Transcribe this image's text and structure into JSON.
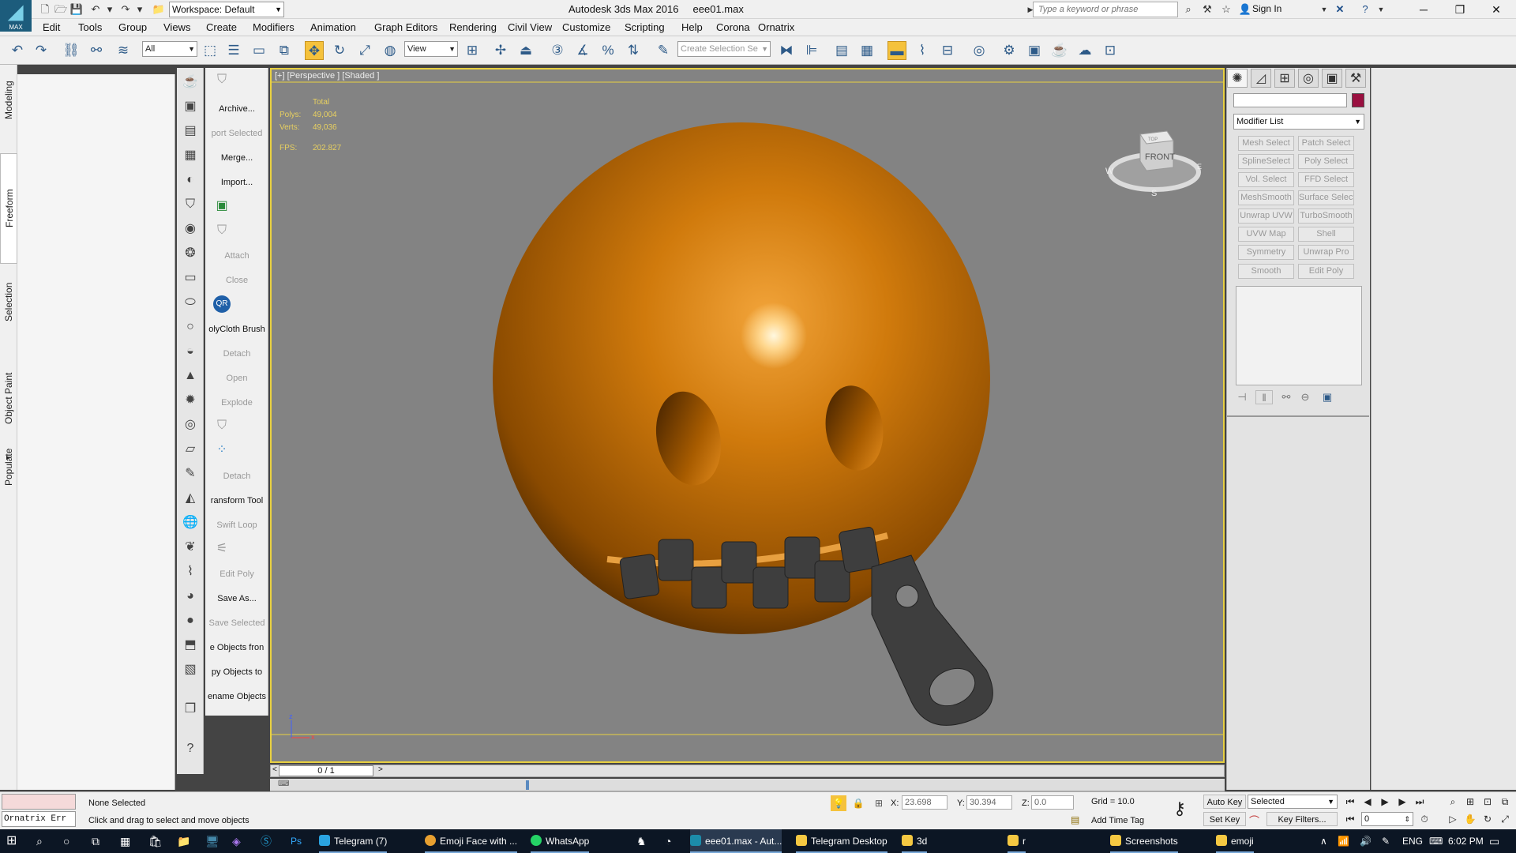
{
  "app": {
    "logo_text": "MAX",
    "workspace": "Workspace: Default",
    "title": "Autodesk 3ds Max 2016",
    "filename": "eee01.max",
    "search_placeholder": "Type a keyword or phrase",
    "sign_in": "Sign In"
  },
  "menus": [
    "Edit",
    "Tools",
    "Group",
    "Views",
    "Create",
    "Modifiers",
    "Animation",
    "Graph Editors",
    "Rendering",
    "Civil View",
    "Customize",
    "Scripting",
    "Help",
    "Corona",
    "Ornatrix"
  ],
  "toolbar": {
    "selection_filter": "All",
    "ref_coord": "View",
    "named_selection_placeholder": "Create Selection Se"
  },
  "ribbon_tabs": [
    "Modeling",
    "Freeform",
    "Selection",
    "Object Paint",
    "Populate"
  ],
  "commands": [
    {
      "label": "Archive...",
      "dim": false
    },
    {
      "label": "port Selected",
      "dim": true
    },
    {
      "label": "Merge...",
      "dim": false
    },
    {
      "label": "Import...",
      "dim": false
    },
    {
      "label": "Attach",
      "dim": true
    },
    {
      "label": "Close",
      "dim": true
    },
    {
      "label": "olyCloth Brush",
      "dim": false
    },
    {
      "label": "Detach",
      "dim": true
    },
    {
      "label": "Open",
      "dim": true
    },
    {
      "label": "Explode",
      "dim": true
    },
    {
      "label": "Detach",
      "dim": true
    },
    {
      "label": "ransform Tool",
      "dim": false
    },
    {
      "label": "Swift Loop",
      "dim": true
    },
    {
      "label": "Edit Poly",
      "dim": true
    },
    {
      "label": "Save As...",
      "dim": false
    },
    {
      "label": "Save Selected",
      "dim": true
    },
    {
      "label": "e Objects fron",
      "dim": false
    },
    {
      "label": "py Objects to",
      "dim": false
    },
    {
      "label": "ename Objects",
      "dim": false
    }
  ],
  "viewport": {
    "label": "[+] [Perspective ] [Shaded ]",
    "stats_header": "Total",
    "polys_label": "Polys:",
    "polys_value": "49,004",
    "verts_label": "Verts:",
    "verts_value": "49,036",
    "fps_label": "FPS:",
    "fps_value": "202.827",
    "viewcube_face": "FRONT",
    "viewcube_top": "TOP",
    "compass_w": "W",
    "compass_s": "S",
    "compass_e": "E",
    "object_color": "#c86d00",
    "zipper_color": "#3e3e3e"
  },
  "timeline": {
    "frame": "0 / 1"
  },
  "command_panel": {
    "modifier_list": "Modifier List",
    "buttons": [
      [
        "Mesh Select",
        "Patch Select"
      ],
      [
        "SplineSelect",
        "Poly Select"
      ],
      [
        "Vol. Select",
        "FFD Select"
      ],
      [
        "MeshSmooth",
        "Surface Select"
      ],
      [
        "Unwrap UVW",
        "TurboSmooth"
      ],
      [
        "UVW Map",
        "Shell"
      ],
      [
        "Symmetry",
        "Unwrap Pro"
      ],
      [
        "Smooth",
        "Edit Poly"
      ]
    ],
    "object_color": "#9a1040"
  },
  "status": {
    "listener": "Ornatrix Err",
    "selection": "None Selected",
    "prompt": "Click and drag to select and move objects",
    "x_label": "X:",
    "x_value": "23.698",
    "y_label": "Y:",
    "y_value": "30.394",
    "z_label": "Z:",
    "z_value": "0.0",
    "grid": "Grid = 10.0",
    "add_time_tag": "Add Time Tag",
    "auto_key": "Auto Key",
    "set_key": "Set Key",
    "selected": "Selected",
    "key_filters": "Key Filters...",
    "frame_value": "0"
  },
  "taskbar": {
    "items": [
      "Telegram (7)",
      "Emoji Face with ...",
      "WhatsApp",
      "eee01.max - Aut...",
      "Telegram Desktop",
      "3d",
      "r",
      "Screenshots",
      "emoji"
    ],
    "lang": "ENG",
    "time": "6:02 PM"
  }
}
